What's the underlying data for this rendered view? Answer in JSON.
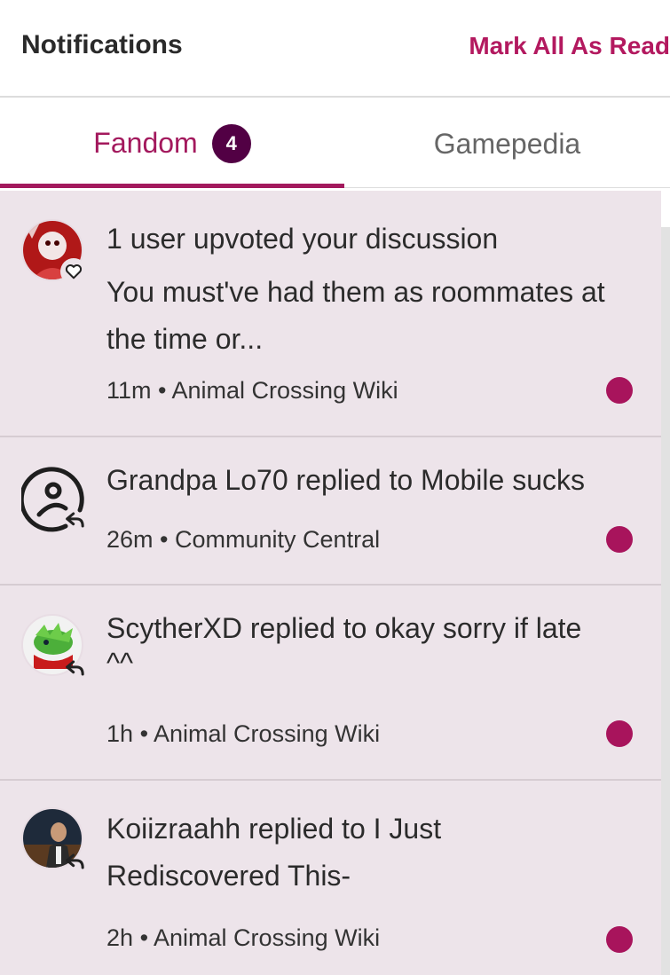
{
  "header": {
    "title": "Notifications",
    "mark_all_label": "Mark All As Read"
  },
  "tabs": [
    {
      "label": "Fandom",
      "badge": "4",
      "active": true
    },
    {
      "label": "Gamepedia",
      "active": false
    }
  ],
  "notifications": [
    {
      "title": "1 user upvoted your discussion",
      "snippet": "You must've had them as roommates at the time or...",
      "time": "11m",
      "separator": "•",
      "wiki": "Animal Crossing Wiki",
      "action_icon": "heart-icon",
      "avatar": "user-avatar"
    },
    {
      "title": "Grandpa Lo70 replied to Mobile sucks",
      "time": "26m",
      "separator": "•",
      "wiki": "Community Central",
      "action_icon": "reply-icon",
      "avatar": "default-user-icon"
    },
    {
      "title": "ScytherXD replied to okay sorry if late",
      "title_line2": "^^",
      "time": "1h",
      "separator": "•",
      "wiki": "Animal Crossing Wiki",
      "action_icon": "reply-icon",
      "avatar": "user-avatar"
    },
    {
      "title": "Koiizraahh replied to I Just Rediscovered This-",
      "time": "2h",
      "separator": "•",
      "wiki": "Animal Crossing Wiki",
      "action_icon": "reply-icon",
      "avatar": "user-avatar"
    }
  ],
  "colors": {
    "accent": "#a3195d",
    "badge": "#520044",
    "unread": "#a8145c",
    "list_bg": "#ede4ea"
  }
}
